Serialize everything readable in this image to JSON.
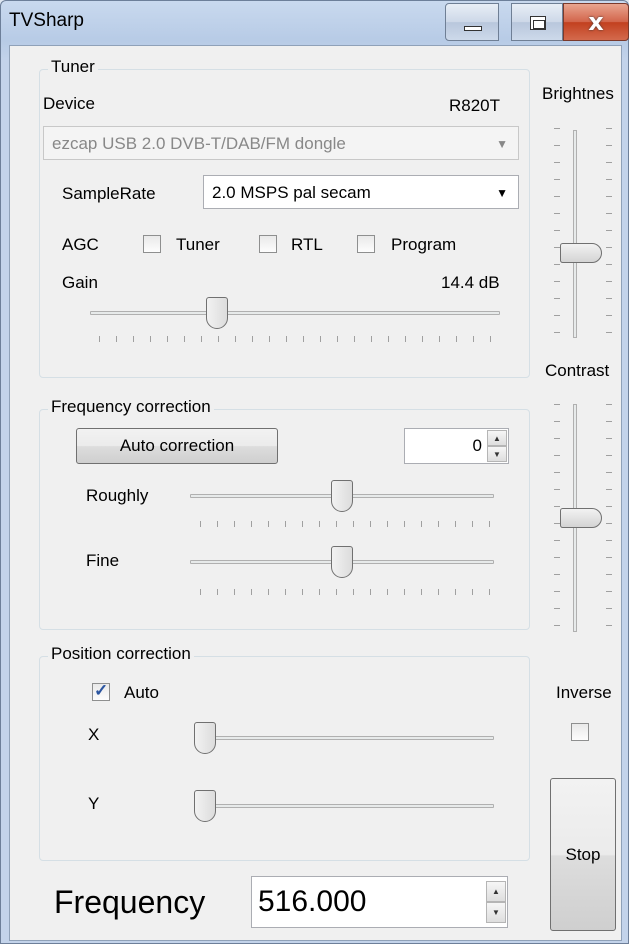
{
  "window": {
    "title": "TVSharp",
    "close_glyph": "x"
  },
  "tuner": {
    "group_label": "Tuner",
    "device_label": "Device",
    "device_model": "R820T",
    "device_value": "ezcap USB 2.0 DVB-T/DAB/FM dongle",
    "samplerate_label": "SampleRate",
    "samplerate_value": "2.0 MSPS pal secam",
    "agc_label": "AGC",
    "agc_tuner_label": "Tuner",
    "agc_rtl_label": "RTL",
    "agc_program_label": "Program",
    "agc_tuner_checked": false,
    "agc_rtl_checked": false,
    "agc_program_checked": false,
    "gain_label": "Gain",
    "gain_value": "14.4 dB",
    "gain_slider_level": 0.3
  },
  "frequency_correction": {
    "group_label": "Frequency correction",
    "auto_button_label": "Auto correction",
    "correction_value": "0",
    "roughly_label": "Roughly",
    "roughly_level": 0.5,
    "fine_label": "Fine",
    "fine_level": 0.5
  },
  "position_correction": {
    "group_label": "Position correction",
    "auto_label": "Auto",
    "auto_checked": true,
    "x_label": "X",
    "x_level": 0.0,
    "y_label": "Y",
    "y_level": 0.0
  },
  "right_panel": {
    "brightness_label": "Brightnes",
    "brightness_level": 0.6,
    "contrast_label": "Contrast",
    "contrast_level": 0.5,
    "inverse_label": "Inverse",
    "inverse_checked": false,
    "stop_button_label": "Stop"
  },
  "frequency": {
    "label": "Frequency",
    "value": "516.000"
  },
  "icons": {
    "minimize": "minimize-icon",
    "maximize": "maximize-icon",
    "close": "close-icon",
    "dropdown": "chevron-down-icon",
    "spin_up": "arrow-up-icon",
    "spin_down": "arrow-down-icon",
    "cursor": "mouse-pointer-icon"
  },
  "colors": {
    "title_bar": "#b7cbe6",
    "close_button": "#c2401f",
    "client_background": "#f0f0f0"
  }
}
